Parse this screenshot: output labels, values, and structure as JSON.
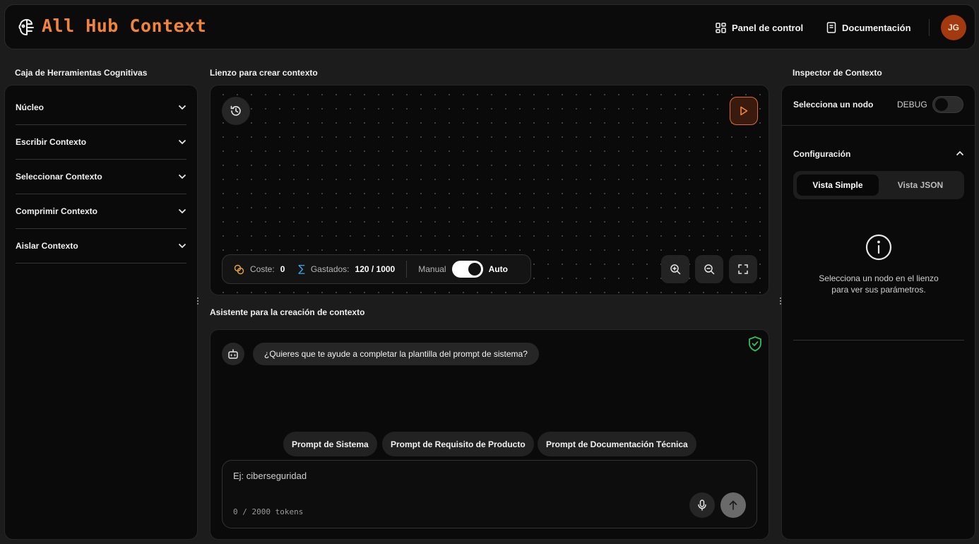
{
  "app": {
    "brand": "All Hub Context",
    "nav_panel": "Panel de control",
    "nav_docs": "Documentación",
    "avatar": "JG",
    "accent": "#f0843a"
  },
  "toolbox": {
    "title": "Caja de Herramientas Cognitivas",
    "items": [
      "Núcleo",
      "Escribir Contexto",
      "Seleccionar Contexto",
      "Comprimir Contexto",
      "Aislar Contexto"
    ]
  },
  "canvas": {
    "title": "Lienzo para crear contexto",
    "cost_label": "Coste:",
    "cost_value": "0",
    "spent_label": "Gastados:",
    "spent_value": "120 / 1000",
    "mode_manual": "Manual",
    "mode_auto": "Auto"
  },
  "assistant": {
    "title": "Asistente para la creación de contexto",
    "message": "¿Quieres que te ayude a completar la plantilla del prompt de sistema?",
    "chips": [
      "Prompt de Sistema",
      "Prompt de Requisito de Producto",
      "Prompt de Documentación Técnica"
    ],
    "input_placeholder": "Ej: ciberseguridad",
    "token_count": "0 / 2000 tokens"
  },
  "inspector": {
    "title": "Inspector de Contexto",
    "select_node": "Selecciona un nodo",
    "debug": "DEBUG",
    "config": "Configuración",
    "tab_simple": "Vista Simple",
    "tab_json": "Vista JSON",
    "empty_message": "Selecciona un nodo en el lienzo para ver sus parámetros."
  }
}
